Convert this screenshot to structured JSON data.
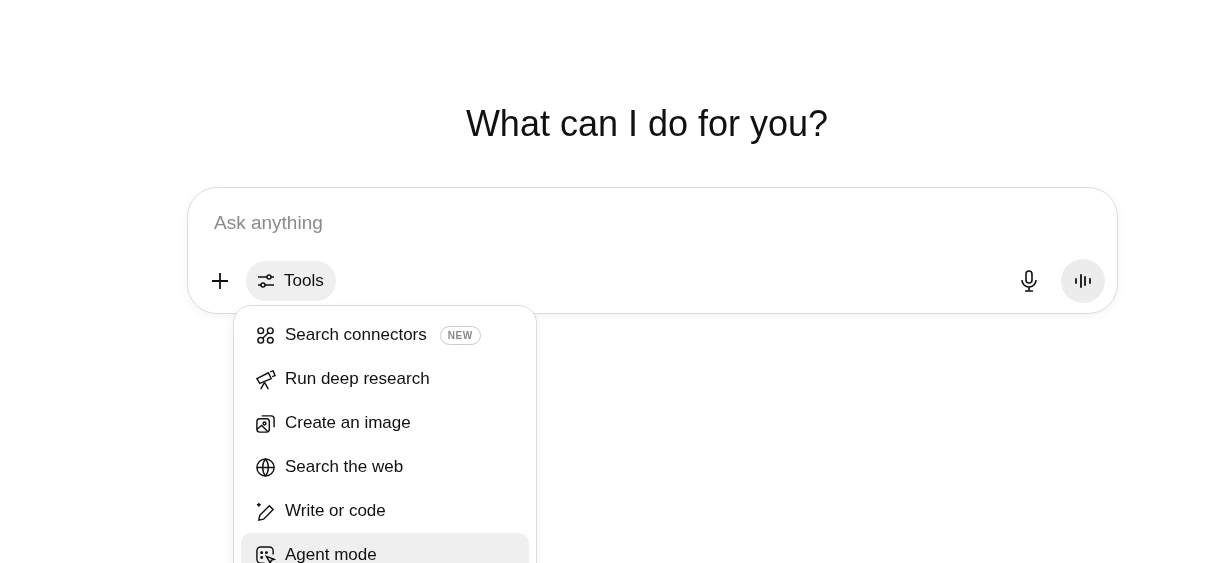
{
  "heading": "What can I do for you?",
  "composer": {
    "placeholder": "Ask anything",
    "tools_label": "Tools"
  },
  "menu": [
    {
      "kind": "connectors",
      "label": "Search connectors",
      "badge": "NEW",
      "selected": false
    },
    {
      "kind": "telescope",
      "label": "Run deep research",
      "selected": false
    },
    {
      "kind": "image",
      "label": "Create an image",
      "selected": false
    },
    {
      "kind": "globe",
      "label": "Search the web",
      "selected": false
    },
    {
      "kind": "pencil",
      "label": "Write or code",
      "selected": false
    },
    {
      "kind": "agent",
      "label": "Agent mode",
      "selected": true
    }
  ]
}
